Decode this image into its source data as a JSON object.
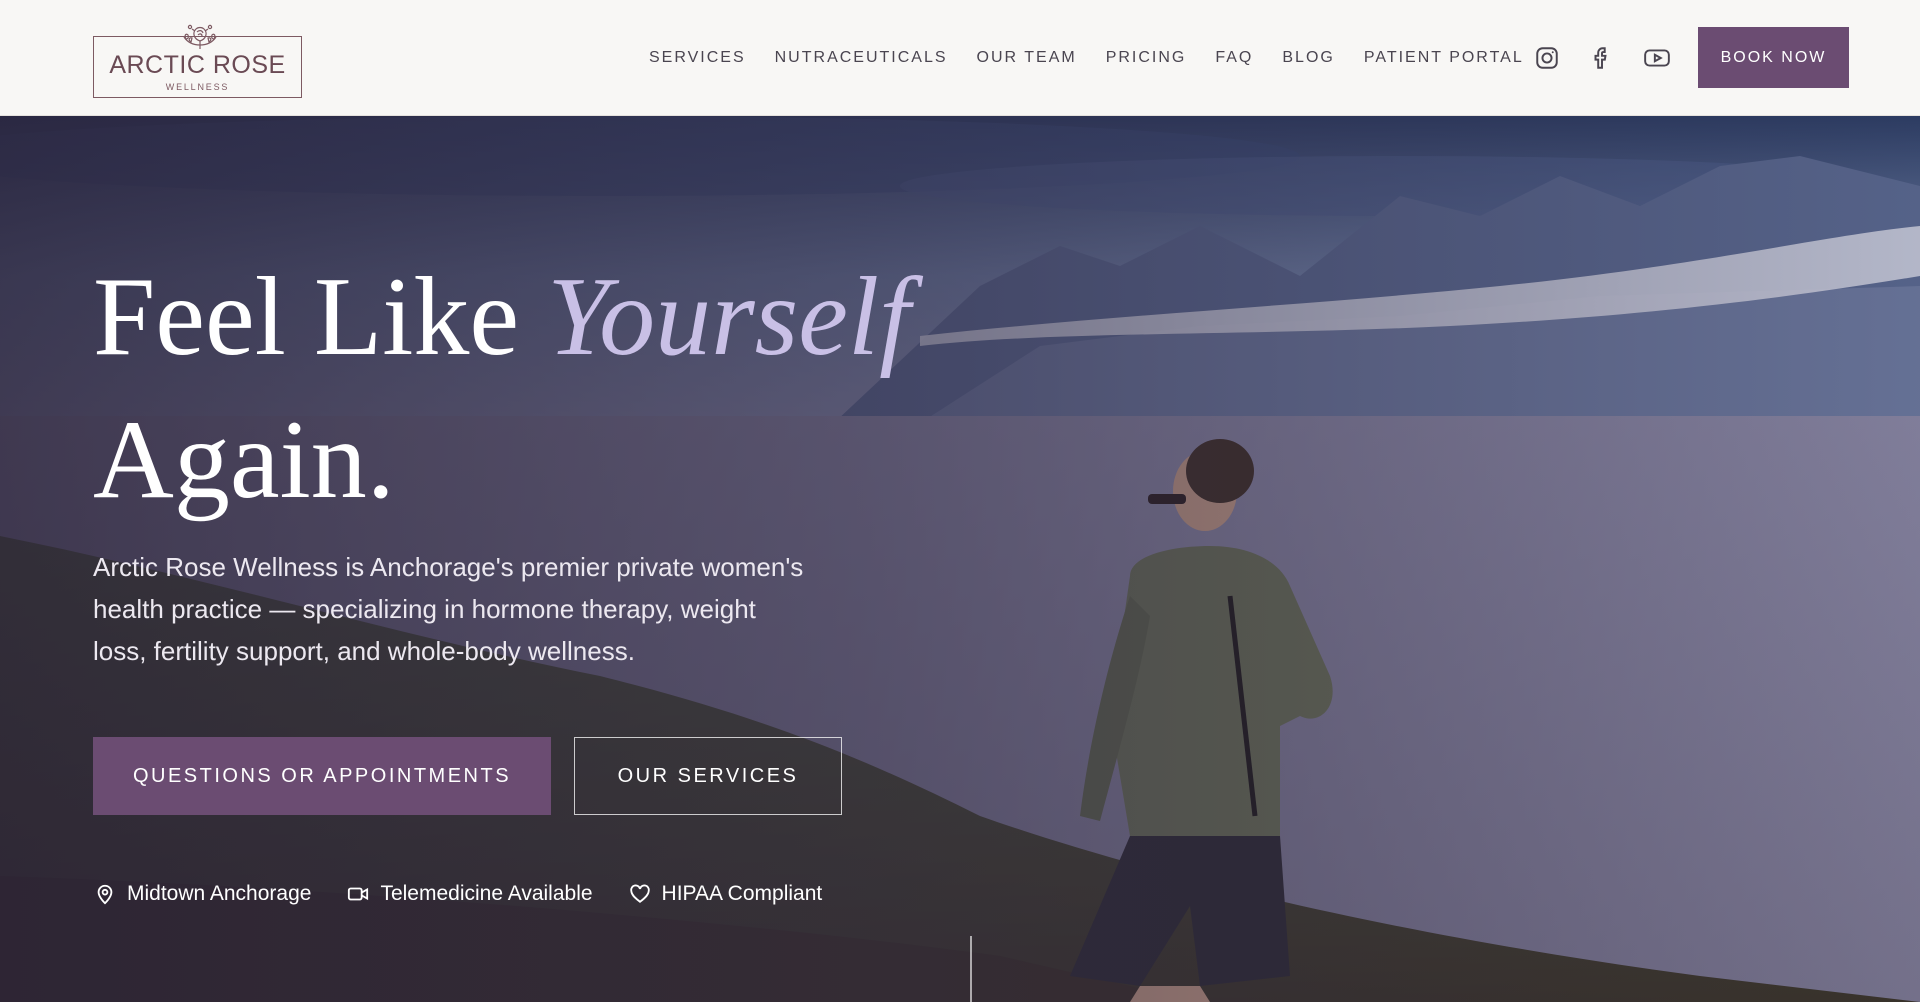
{
  "brand": {
    "name": "ARCTIC ROSE",
    "tagline": "WELLNESS"
  },
  "nav": {
    "links": [
      "SERVICES",
      "NUTRACEUTICALS",
      "OUR TEAM",
      "PRICING",
      "FAQ",
      "BLOG",
      "PATIENT PORTAL"
    ],
    "socials": [
      "instagram-icon",
      "facebook-icon",
      "youtube-icon"
    ],
    "book_label": "BOOK NOW"
  },
  "hero": {
    "title_line1": "Feel Like",
    "title_accent": "Yourself",
    "title_line2": "Again.",
    "description": "Arctic Rose Wellness is Anchorage's premier private women's health practice — specializing in hormone therapy, weight loss, fertility support, and whole-body wellness.",
    "primary_cta": "QUESTIONS OR APPOINTMENTS",
    "secondary_cta": "OUR SERVICES",
    "features": [
      {
        "icon": "map-pin-icon",
        "label": "Midtown Anchorage"
      },
      {
        "icon": "video-camera-icon",
        "label": "Telemedicine Available"
      },
      {
        "icon": "heart-icon",
        "label": "HIPAA Compliant"
      }
    ]
  },
  "colors": {
    "brand_purple": "#6b4c72",
    "accent_lavender": "#c9c0e6",
    "header_bg": "#f8f7f5",
    "nav_text": "#4a4550",
    "logo_rose": "#7d5a62"
  }
}
